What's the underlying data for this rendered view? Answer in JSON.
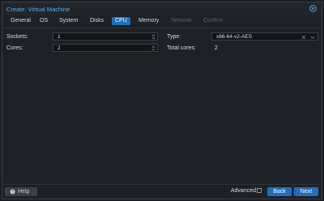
{
  "window": {
    "title": "Create: Virtual Machine"
  },
  "tabs": [
    {
      "label": "General",
      "state": "normal"
    },
    {
      "label": "OS",
      "state": "normal"
    },
    {
      "label": "System",
      "state": "normal"
    },
    {
      "label": "Disks",
      "state": "normal"
    },
    {
      "label": "CPU",
      "state": "active"
    },
    {
      "label": "Memory",
      "state": "normal"
    },
    {
      "label": "Network",
      "state": "disabled"
    },
    {
      "label": "Confirm",
      "state": "disabled"
    }
  ],
  "form": {
    "sockets": {
      "label": "Sockets:",
      "value": "1"
    },
    "cores": {
      "label": "Cores:",
      "value": "2"
    },
    "type": {
      "label": "Type:",
      "value": "x86-64-v2-AES"
    },
    "total_cores": {
      "label": "Total cores:",
      "value": "2"
    }
  },
  "footer": {
    "help_label": "Help",
    "advanced_label": "Advanced",
    "advanced_checked": false,
    "back_label": "Back",
    "next_label": "Next"
  },
  "colors": {
    "accent": "#1f6fb8",
    "title": "#5aa9e6",
    "background": "#1e2126"
  }
}
